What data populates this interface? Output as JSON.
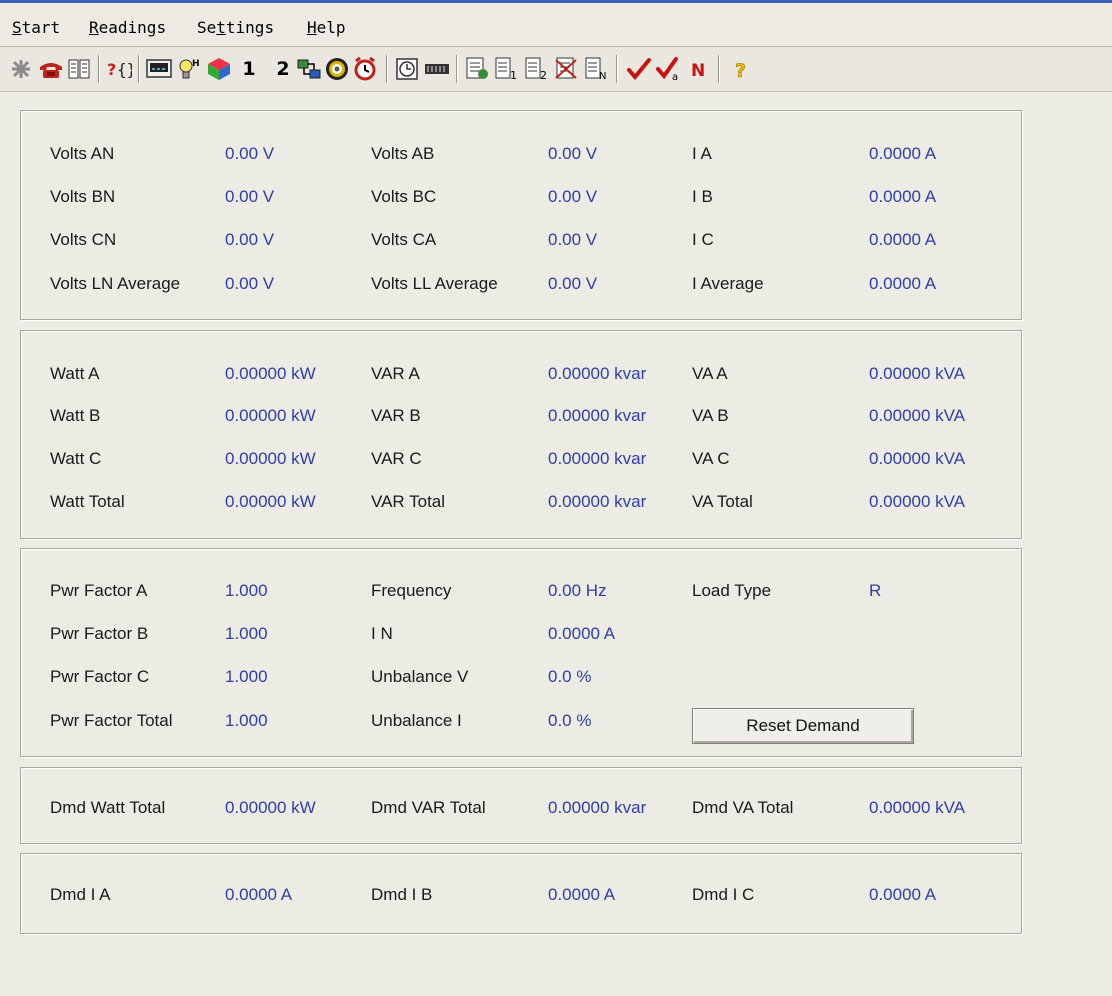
{
  "menu": [
    {
      "label": "Start",
      "accel": "S",
      "rest": "tart"
    },
    {
      "label": "Readings",
      "accel": "R",
      "rest": "eadings"
    },
    {
      "label": "Settings",
      "pre": "Se",
      "accel": "t",
      "rest": "tings"
    },
    {
      "label": "Help",
      "accel": "H",
      "rest": "elp"
    }
  ],
  "toolbar": {
    "btn_one": "1",
    "btn_two": "2"
  },
  "colors": {
    "label": "#1a1a1a",
    "value": "#2e3fa8",
    "check": "#cc1111",
    "neutral_n": "#cc1111",
    "help": "#e8b800"
  },
  "voltage_current": {
    "rows": [
      {
        "l1": "Volts AN",
        "v1": "0.00 V",
        "l2": "Volts AB",
        "v2": "0.00 V",
        "l3": "I A",
        "v3": "0.0000 A"
      },
      {
        "l1": "Volts BN",
        "v1": "0.00 V",
        "l2": "Volts BC",
        "v2": "0.00 V",
        "l3": "I B",
        "v3": "0.0000 A"
      },
      {
        "l1": "Volts CN",
        "v1": "0.00 V",
        "l2": "Volts CA",
        "v2": "0.00 V",
        "l3": "I C",
        "v3": "0.0000 A"
      },
      {
        "l1": "Volts LN Average",
        "v1": "0.00 V",
        "l2": "Volts LL Average",
        "v2": "0.00 V",
        "l3": "I Average",
        "v3": "0.0000 A"
      }
    ]
  },
  "power": {
    "rows": [
      {
        "l1": "Watt A",
        "v1": "0.00000 kW",
        "l2": "VAR A",
        "v2": "0.00000 kvar",
        "l3": "VA A",
        "v3": "0.00000 kVA"
      },
      {
        "l1": "Watt B",
        "v1": "0.00000 kW",
        "l2": "VAR B",
        "v2": "0.00000 kvar",
        "l3": "VA B",
        "v3": "0.00000 kVA"
      },
      {
        "l1": "Watt C",
        "v1": "0.00000 kW",
        "l2": "VAR C",
        "v2": "0.00000 kvar",
        "l3": "VA C",
        "v3": "0.00000 kVA"
      },
      {
        "l1": "Watt Total",
        "v1": "0.00000 kW",
        "l2": "VAR Total",
        "v2": "0.00000 kvar",
        "l3": "VA Total",
        "v3": "0.00000 kVA"
      }
    ]
  },
  "factor": {
    "rows": [
      {
        "l1": "Pwr Factor A",
        "v1": "1.000",
        "l2": "Frequency",
        "v2": "0.00 Hz",
        "l3": "Load Type",
        "v3": "R"
      },
      {
        "l1": "Pwr Factor B",
        "v1": "1.000",
        "l2": "I N",
        "v2": "0.0000 A"
      },
      {
        "l1": "Pwr Factor C",
        "v1": "1.000",
        "l2": "Unbalance V",
        "v2": "0.0 %"
      },
      {
        "l1": "Pwr Factor Total",
        "v1": "1.000",
        "l2": "Unbalance I",
        "v2": "0.0 %"
      }
    ],
    "reset_button": "Reset Demand"
  },
  "demand_power": {
    "l1": "Dmd Watt Total",
    "v1": "0.00000 kW",
    "l2": "Dmd VAR Total",
    "v2": "0.00000 kvar",
    "l3": "Dmd VA Total",
    "v3": "0.00000 kVA"
  },
  "demand_current": {
    "l1": "Dmd I A",
    "v1": "0.0000 A",
    "l2": "Dmd I B",
    "v2": "0.0000 A",
    "l3": "Dmd I C",
    "v3": "0.0000 A"
  }
}
